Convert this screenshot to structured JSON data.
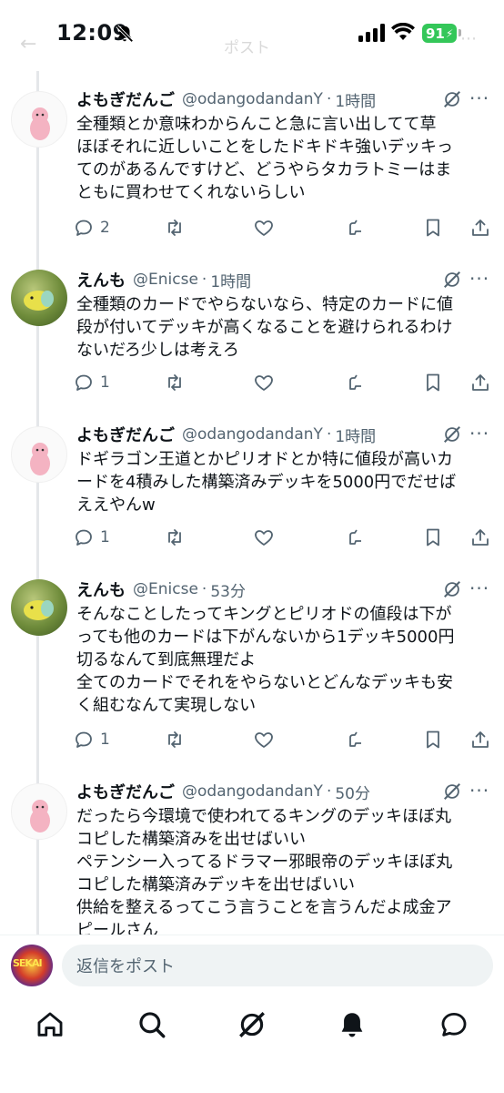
{
  "status_bar": {
    "time": "12:09",
    "battery": "91"
  },
  "header": {
    "back_glyph": "←",
    "title": "ポスト",
    "more_glyph": "⋯"
  },
  "tweets": [
    {
      "name": "よもぎだんご",
      "handle": "@odangodandanY",
      "time": "1時間",
      "lines": [
        "全種類とか意味わからんこと急に言い出してて草",
        "ほぼそれに近しいことをしたドキドキ強いデッキっ",
        "てのがあるんですけど、どうやらタカラトミーはま",
        "ともに買わせてくれないらしい"
      ],
      "replies": "2"
    },
    {
      "name": "えんも",
      "handle": "@Enicse",
      "time": "1時間",
      "lines": [
        "全種類のカードでやらないなら、特定のカードに値",
        "段が付いてデッキが高くなることを避けられるわけ",
        "ないだろ少しは考えろ"
      ],
      "replies": "1"
    },
    {
      "name": "よもぎだんご",
      "handle": "@odangodandanY",
      "time": "1時間",
      "lines": [
        "ドギラゴン王道とかピリオドとか特に値段が高いカ",
        "ードを4積みした構築済みデッキを5000円でだせば",
        "ええやんw"
      ],
      "replies": "1"
    },
    {
      "name": "えんも",
      "handle": "@Enicse",
      "time": "53分",
      "lines": [
        "そんなことしたってキングとピリオドの値段は下が",
        "っても他のカードは下がんないから1デッキ5000円",
        "切るなんて到底無理だよ",
        "全てのカードでそれをやらないとどんなデッキも安",
        "く組むなんて実現しない"
      ],
      "replies": "1"
    },
    {
      "name": "よもぎだんご",
      "handle": "@odangodandanY",
      "time": "50分",
      "lines": [
        "だったら今環境で使われてるキングのデッキほぼ丸",
        "コピした構築済みを出せばいい",
        "ペテンシー入ってるドラマー邪眼帝のデッキほぼ丸",
        "コピした構築済みデッキを出せばいい",
        "供給を整えるってこう言うことを言うんだよ成金ア",
        "ピールさん"
      ],
      "replies": ""
    }
  ],
  "reply_bar": {
    "placeholder": "返信をポスト",
    "avatar_text": "SEKAI"
  },
  "icons": {
    "reply": "reply-icon",
    "retweet": "retweet-icon",
    "like": "heart-icon",
    "grok": "grok-icon",
    "bookmark": "bookmark-icon",
    "share": "share-icon",
    "nav": [
      "home-icon",
      "search-icon",
      "grok-icon",
      "notifications-icon",
      "messages-icon"
    ]
  },
  "colors": {
    "text": "#0f1419",
    "secondary": "#536471",
    "battery": "#34c759",
    "thread_line": "#e5e7ea"
  }
}
